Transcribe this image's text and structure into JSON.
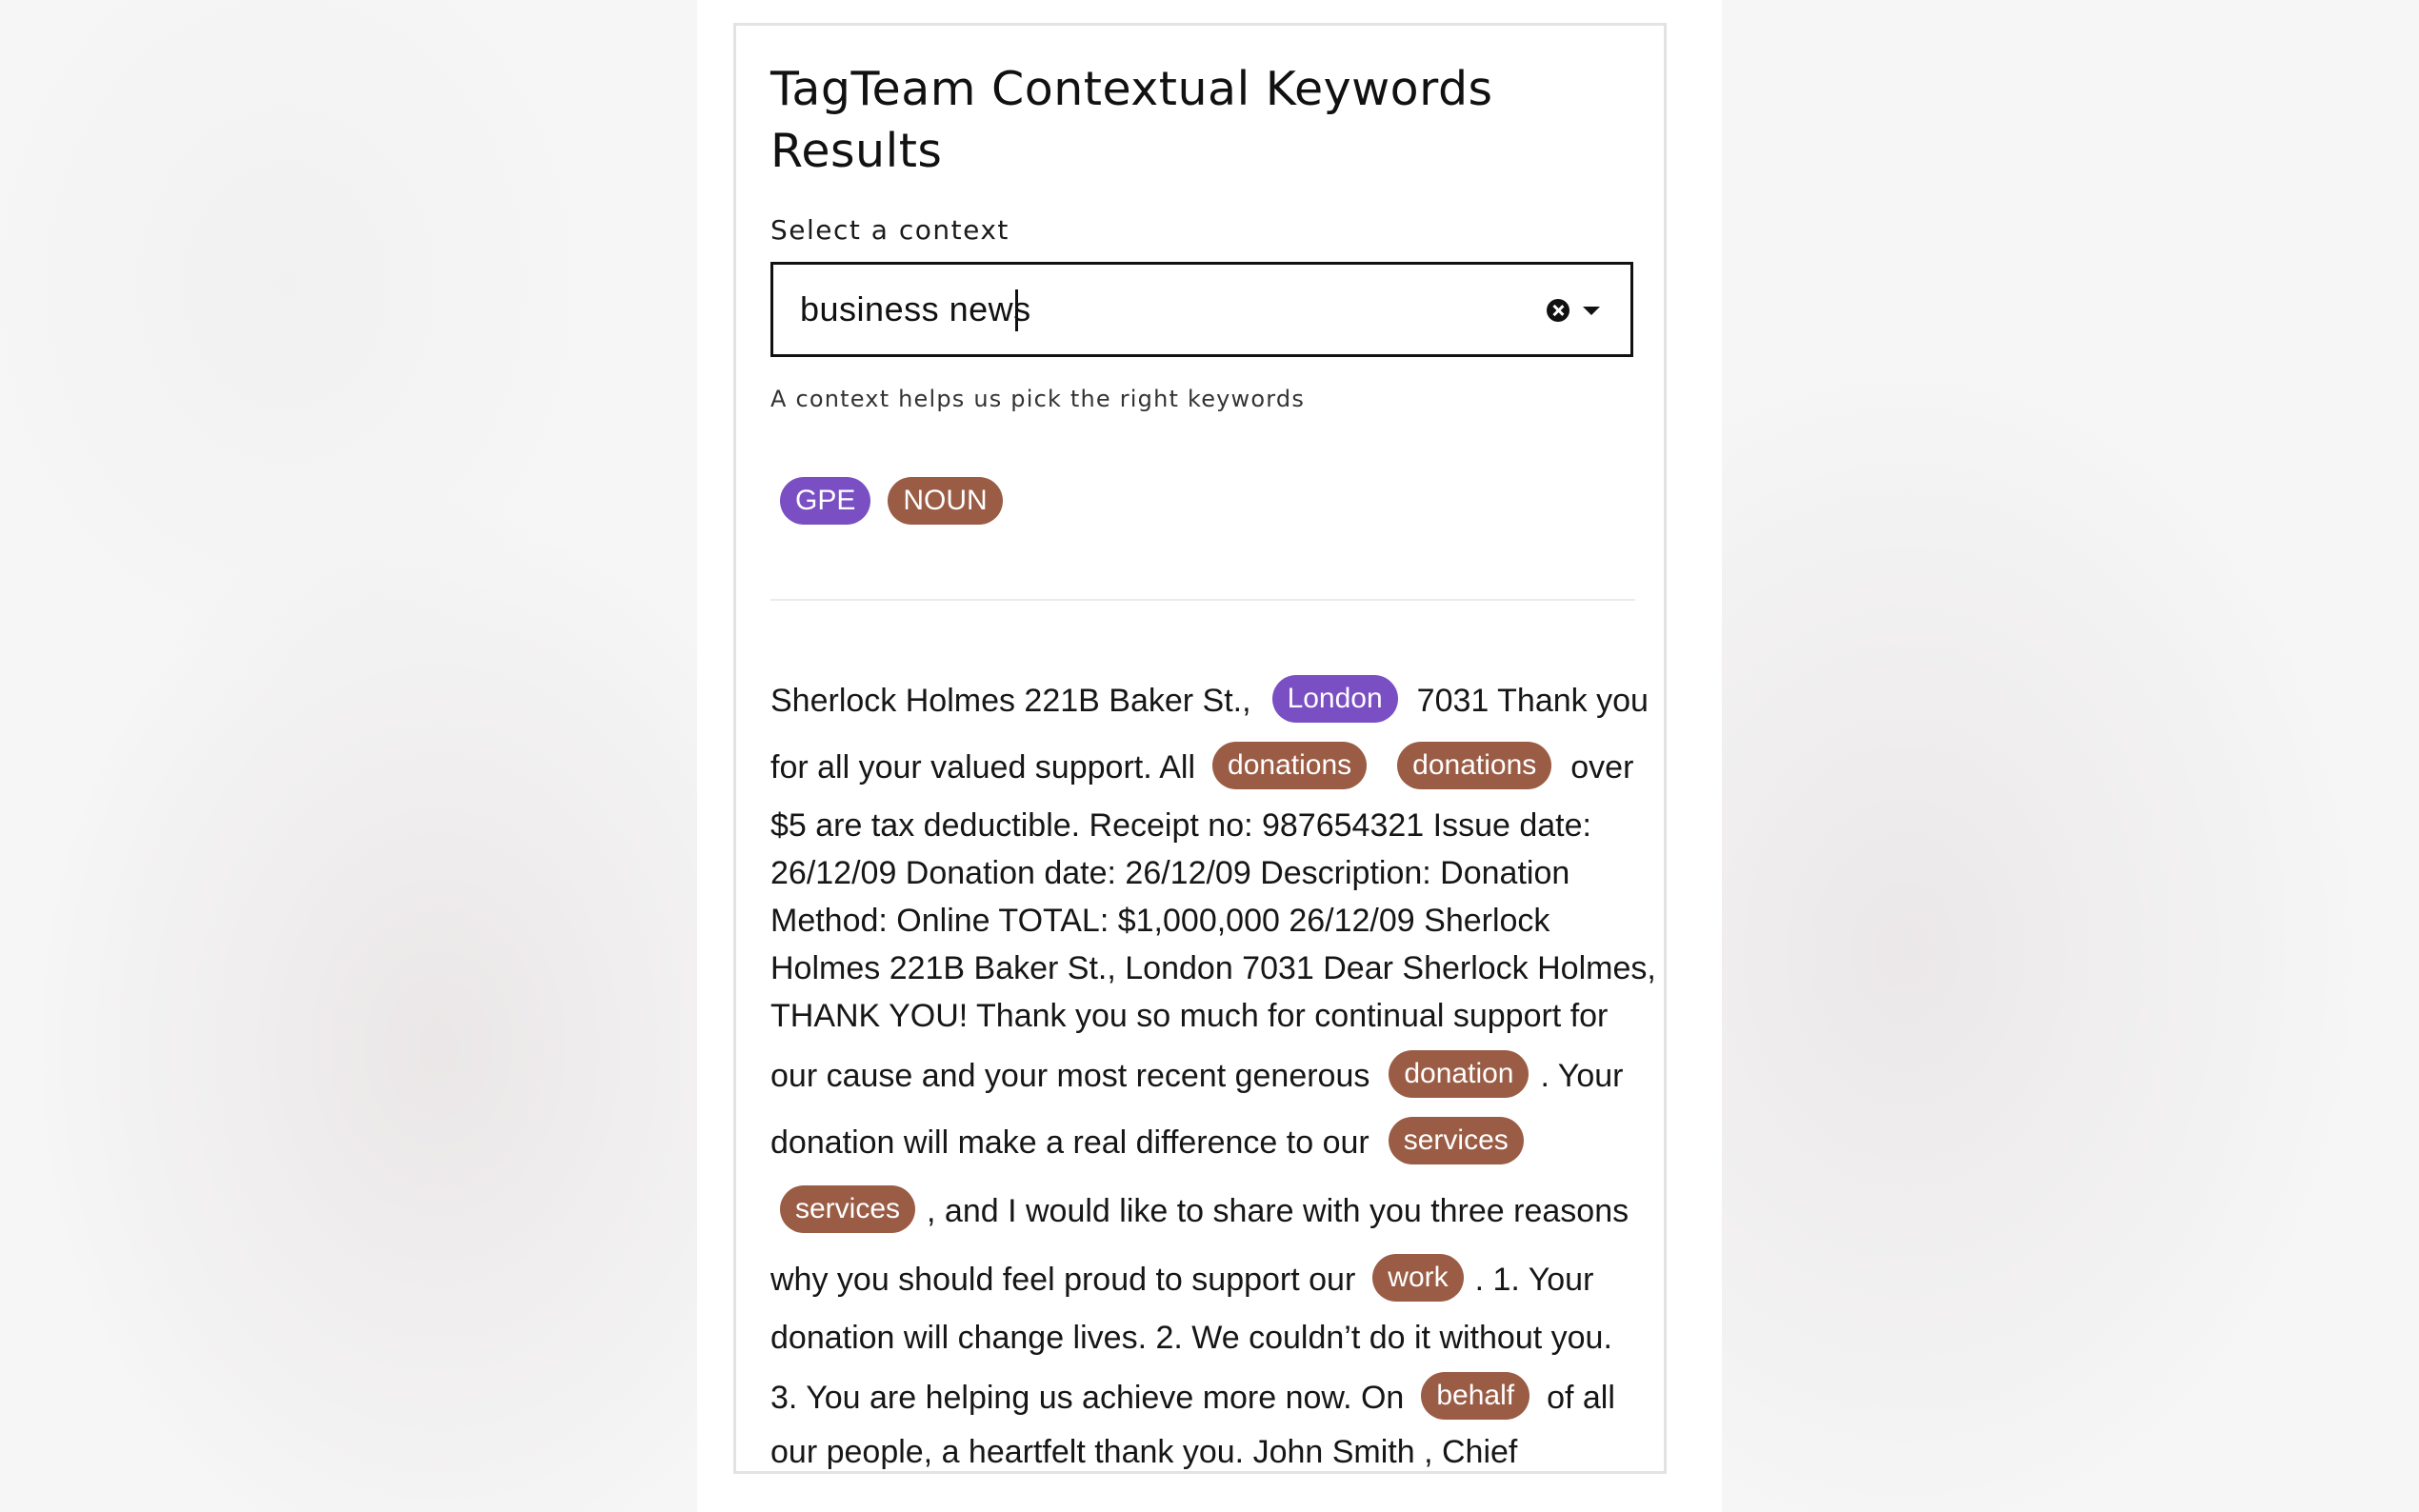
{
  "page": {
    "title": "TagTeam Contextual Keywords Results"
  },
  "context_select": {
    "label": "Select a context",
    "value": "business news",
    "helper": "A context helps us pick the right keywords"
  },
  "legend": [
    {
      "label": "GPE",
      "color": "#7a4fc3"
    },
    {
      "label": "NOUN",
      "color": "#9a5c45"
    }
  ],
  "icons": {
    "clear": "close-circle-icon",
    "dropdown": "chevron-down-icon"
  },
  "tagged_text": {
    "lines": [
      [
        {
          "t": "Sherlock Holmes 221B Baker St.,"
        },
        {
          "tag": "London",
          "type": "GPE"
        },
        {
          "t": "7031 Thank you"
        }
      ],
      [
        {
          "t": "for all your valued support. All"
        },
        {
          "tag": "donations",
          "type": "NOUN"
        },
        {
          "tag": "donations",
          "type": "NOUN"
        },
        {
          "t": "over"
        }
      ],
      [
        {
          "t": "$5 are tax deductible. Receipt no: 987654321 Issue date:"
        }
      ],
      [
        {
          "t": "26/12/09 Donation date: 26/12/09 Description: Donation"
        }
      ],
      [
        {
          "t": "Method: Online TOTAL: $1,000,000 26/12/09 Sherlock"
        }
      ],
      [
        {
          "t": "Holmes 221B Baker St., London 7031 Dear Sherlock Holmes,"
        }
      ],
      [
        {
          "t": "THANK YOU! Thank you so much for continual support for"
        }
      ],
      [
        {
          "t": "our cause and your most recent generous"
        },
        {
          "tag": "donation",
          "type": "NOUN"
        },
        {
          "t": ". Your"
        }
      ],
      [
        {
          "t": "donation will make a real difference to our"
        },
        {
          "tag": "services",
          "type": "NOUN"
        }
      ],
      [
        {
          "tag": "services",
          "type": "NOUN"
        },
        {
          "t": ", and I would like to share with you three reasons"
        }
      ],
      [
        {
          "t": "why you should feel proud to support our"
        },
        {
          "tag": "work",
          "type": "NOUN"
        },
        {
          "t": ". 1. Your"
        }
      ],
      [
        {
          "t": "donation will change lives. 2. We couldn’t do it without you."
        }
      ],
      [
        {
          "t": "3. You are helping us achieve more now. On"
        },
        {
          "tag": "behalf",
          "type": "NOUN"
        },
        {
          "t": "of all"
        }
      ],
      [
        {
          "t": "our people, a heartfelt thank you. John Smith , Chief"
        }
      ]
    ]
  }
}
